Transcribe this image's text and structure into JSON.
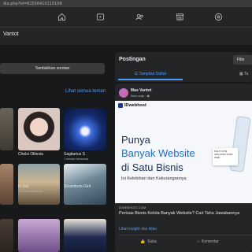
{
  "browser": {
    "url": "dia.php?id=61556410115109"
  },
  "profile": {
    "name": "Vantot"
  },
  "left": {
    "add_highlight_label": "Tambahkan sorotan",
    "see_all_friends": "Lihat semua teman",
    "friends": [
      {
        "name": "",
        "sub": ""
      },
      {
        "name": "Chelsi Olitevia",
        "sub": ""
      },
      {
        "name": "Sagitarius S",
        "sub": "1 teman bersama"
      },
      {
        "name": "Fi Suf",
        "sub": "2 teman bersama"
      },
      {
        "name": "",
        "sub": ""
      },
      {
        "name": "Sinambela Gint",
        "sub": ""
      }
    ]
  },
  "posts": {
    "title": "Postingan",
    "filter_label": "Filte",
    "tab_list": "Tampilan Daftar",
    "tab_grid": "Ta",
    "author": "Mas Vantot",
    "time": "Baru saja",
    "ad": {
      "brand": "IDwebhost",
      "line1": "Punya",
      "line2": "Banyak Website",
      "line3": "di Satu Bisnis",
      "sub": "Ini Kelebihan dan Kekurangannya",
      "card_text": "MULTI SITE ARCHITECTURE WEB"
    },
    "domain": "IDWEBHOST.COM",
    "headline": "Perluas Bisnis Kelola Banyak Website? Cari Tahu Jawabannya",
    "insight_label": "Lihat insight dan iklan",
    "like_label": "Suka",
    "comment_label": "Komentar"
  }
}
